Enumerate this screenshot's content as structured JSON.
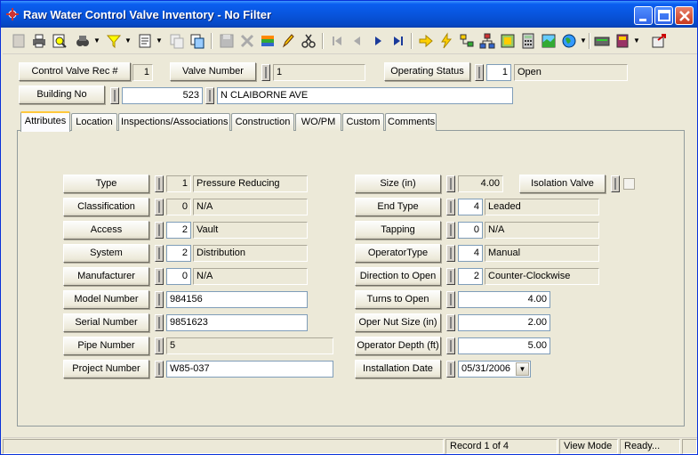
{
  "window": {
    "title": "Raw Water Control Valve Inventory - No Filter"
  },
  "toolbar": {
    "icons": [
      "new-icon",
      "print-icon",
      "print-preview-icon",
      "search-icon",
      "filter-icon",
      "report-icon",
      "copy-icon",
      "view-icon",
      "save-icon",
      "delete-icon",
      "attach-icon",
      "edit-icon",
      "cut-icon",
      "first-record-icon",
      "prev-record-icon",
      "next-record-icon",
      "last-record-icon",
      "go-icon",
      "lightning-icon",
      "tree-icon",
      "hierarchy-icon",
      "map-icon",
      "calculator-icon",
      "gis-icon",
      "globe-icon",
      "keyboard-icon",
      "book-icon",
      "exit-icon"
    ]
  },
  "header": {
    "rec_label": "Control Valve Rec #",
    "rec_value": "1",
    "valve_number_label": "Valve Number",
    "valve_number_value": "1",
    "operating_status_label": "Operating Status",
    "operating_status_code": "1",
    "operating_status_value": "Open",
    "building_label": "Building No",
    "building_no": "523",
    "building_street": "N CLAIBORNE AVE"
  },
  "tabs": [
    {
      "label": "Attributes"
    },
    {
      "label": "Location"
    },
    {
      "label": "Inspections/Associations"
    },
    {
      "label": "Construction"
    },
    {
      "label": "WO/PM"
    },
    {
      "label": "Custom"
    },
    {
      "label": "Comments"
    }
  ],
  "attributes": {
    "type": {
      "label": "Type",
      "code": "1",
      "value": "Pressure Reducing"
    },
    "classification": {
      "label": "Classification",
      "code": "0",
      "value": "N/A"
    },
    "access": {
      "label": "Access",
      "code": "2",
      "value": "Vault"
    },
    "system": {
      "label": "System",
      "code": "2",
      "value": "Distribution"
    },
    "manufacturer": {
      "label": "Manufacturer",
      "code": "0",
      "value": "N/A"
    },
    "model_number": {
      "label": "Model Number",
      "value": "984156"
    },
    "serial_number": {
      "label": "Serial Number",
      "value": "9851623"
    },
    "pipe_number": {
      "label": "Pipe Number",
      "value": "5"
    },
    "project_number": {
      "label": "Project Number",
      "value": "W85-037"
    },
    "size": {
      "label": "Size (in)",
      "value": "4.00"
    },
    "isolation_valve": {
      "label": "Isolation Valve",
      "checked": false
    },
    "end_type": {
      "label": "End Type",
      "code": "4",
      "value": "Leaded"
    },
    "tapping": {
      "label": "Tapping",
      "code": "0",
      "value": "N/A"
    },
    "operator_type": {
      "label": "OperatorType",
      "code": "4",
      "value": "Manual"
    },
    "direction_to_open": {
      "label": "Direction to Open",
      "code": "2",
      "value": "Counter-Clockwise"
    },
    "turns_to_open": {
      "label": "Turns to Open",
      "value": "4.00"
    },
    "oper_nut_size": {
      "label": "Oper Nut Size (in)",
      "value": "2.00"
    },
    "operator_depth": {
      "label": "Operator Depth (ft)",
      "value": "5.00"
    },
    "installation_date": {
      "label": "Installation Date",
      "value": "05/31/2006"
    }
  },
  "status": {
    "record": "Record 1 of 4",
    "mode": "View Mode",
    "state": "Ready..."
  }
}
